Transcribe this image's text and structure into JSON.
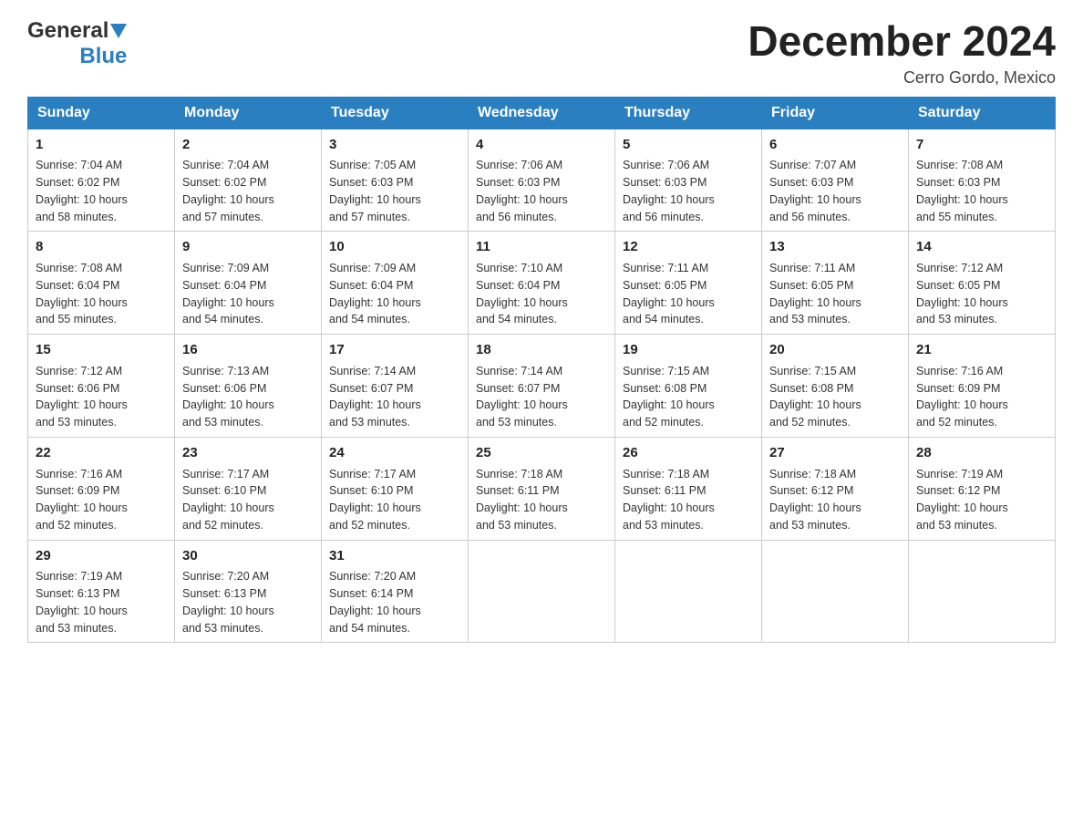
{
  "header": {
    "logo_general": "General",
    "logo_blue": "Blue",
    "month_title": "December 2024",
    "location": "Cerro Gordo, Mexico"
  },
  "days_of_week": [
    "Sunday",
    "Monday",
    "Tuesday",
    "Wednesday",
    "Thursday",
    "Friday",
    "Saturday"
  ],
  "weeks": [
    [
      {
        "day": "1",
        "sunrise": "7:04 AM",
        "sunset": "6:02 PM",
        "daylight": "10 hours and 58 minutes."
      },
      {
        "day": "2",
        "sunrise": "7:04 AM",
        "sunset": "6:02 PM",
        "daylight": "10 hours and 57 minutes."
      },
      {
        "day": "3",
        "sunrise": "7:05 AM",
        "sunset": "6:03 PM",
        "daylight": "10 hours and 57 minutes."
      },
      {
        "day": "4",
        "sunrise": "7:06 AM",
        "sunset": "6:03 PM",
        "daylight": "10 hours and 56 minutes."
      },
      {
        "day": "5",
        "sunrise": "7:06 AM",
        "sunset": "6:03 PM",
        "daylight": "10 hours and 56 minutes."
      },
      {
        "day": "6",
        "sunrise": "7:07 AM",
        "sunset": "6:03 PM",
        "daylight": "10 hours and 56 minutes."
      },
      {
        "day": "7",
        "sunrise": "7:08 AM",
        "sunset": "6:03 PM",
        "daylight": "10 hours and 55 minutes."
      }
    ],
    [
      {
        "day": "8",
        "sunrise": "7:08 AM",
        "sunset": "6:04 PM",
        "daylight": "10 hours and 55 minutes."
      },
      {
        "day": "9",
        "sunrise": "7:09 AM",
        "sunset": "6:04 PM",
        "daylight": "10 hours and 54 minutes."
      },
      {
        "day": "10",
        "sunrise": "7:09 AM",
        "sunset": "6:04 PM",
        "daylight": "10 hours and 54 minutes."
      },
      {
        "day": "11",
        "sunrise": "7:10 AM",
        "sunset": "6:04 PM",
        "daylight": "10 hours and 54 minutes."
      },
      {
        "day": "12",
        "sunrise": "7:11 AM",
        "sunset": "6:05 PM",
        "daylight": "10 hours and 54 minutes."
      },
      {
        "day": "13",
        "sunrise": "7:11 AM",
        "sunset": "6:05 PM",
        "daylight": "10 hours and 53 minutes."
      },
      {
        "day": "14",
        "sunrise": "7:12 AM",
        "sunset": "6:05 PM",
        "daylight": "10 hours and 53 minutes."
      }
    ],
    [
      {
        "day": "15",
        "sunrise": "7:12 AM",
        "sunset": "6:06 PM",
        "daylight": "10 hours and 53 minutes."
      },
      {
        "day": "16",
        "sunrise": "7:13 AM",
        "sunset": "6:06 PM",
        "daylight": "10 hours and 53 minutes."
      },
      {
        "day": "17",
        "sunrise": "7:14 AM",
        "sunset": "6:07 PM",
        "daylight": "10 hours and 53 minutes."
      },
      {
        "day": "18",
        "sunrise": "7:14 AM",
        "sunset": "6:07 PM",
        "daylight": "10 hours and 53 minutes."
      },
      {
        "day": "19",
        "sunrise": "7:15 AM",
        "sunset": "6:08 PM",
        "daylight": "10 hours and 52 minutes."
      },
      {
        "day": "20",
        "sunrise": "7:15 AM",
        "sunset": "6:08 PM",
        "daylight": "10 hours and 52 minutes."
      },
      {
        "day": "21",
        "sunrise": "7:16 AM",
        "sunset": "6:09 PM",
        "daylight": "10 hours and 52 minutes."
      }
    ],
    [
      {
        "day": "22",
        "sunrise": "7:16 AM",
        "sunset": "6:09 PM",
        "daylight": "10 hours and 52 minutes."
      },
      {
        "day": "23",
        "sunrise": "7:17 AM",
        "sunset": "6:10 PM",
        "daylight": "10 hours and 52 minutes."
      },
      {
        "day": "24",
        "sunrise": "7:17 AM",
        "sunset": "6:10 PM",
        "daylight": "10 hours and 52 minutes."
      },
      {
        "day": "25",
        "sunrise": "7:18 AM",
        "sunset": "6:11 PM",
        "daylight": "10 hours and 53 minutes."
      },
      {
        "day": "26",
        "sunrise": "7:18 AM",
        "sunset": "6:11 PM",
        "daylight": "10 hours and 53 minutes."
      },
      {
        "day": "27",
        "sunrise": "7:18 AM",
        "sunset": "6:12 PM",
        "daylight": "10 hours and 53 minutes."
      },
      {
        "day": "28",
        "sunrise": "7:19 AM",
        "sunset": "6:12 PM",
        "daylight": "10 hours and 53 minutes."
      }
    ],
    [
      {
        "day": "29",
        "sunrise": "7:19 AM",
        "sunset": "6:13 PM",
        "daylight": "10 hours and 53 minutes."
      },
      {
        "day": "30",
        "sunrise": "7:20 AM",
        "sunset": "6:13 PM",
        "daylight": "10 hours and 53 minutes."
      },
      {
        "day": "31",
        "sunrise": "7:20 AM",
        "sunset": "6:14 PM",
        "daylight": "10 hours and 54 minutes."
      },
      null,
      null,
      null,
      null
    ]
  ],
  "labels": {
    "sunrise": "Sunrise:",
    "sunset": "Sunset:",
    "daylight": "Daylight:"
  }
}
